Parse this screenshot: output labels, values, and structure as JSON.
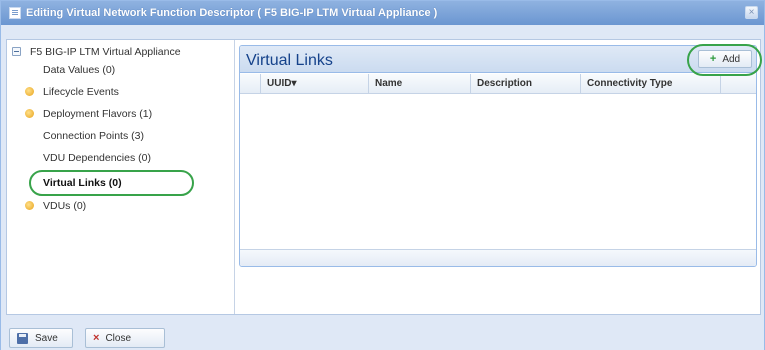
{
  "window": {
    "title": "Editing Virtual Network Function Descriptor ( F5 BIG-IP LTM Virtual Appliance )",
    "close_glyph": "×"
  },
  "tree": {
    "root": "F5 BIG-IP LTM Virtual Appliance",
    "items": [
      {
        "label": "Data Values (0)",
        "icon": "none"
      },
      {
        "label": "Lifecycle Events",
        "icon": "folder-icon"
      },
      {
        "label": "Deployment Flavors (1)",
        "icon": "folder-icon"
      },
      {
        "label": "Connection Points (3)",
        "icon": "none"
      },
      {
        "label": "VDU Dependencies (0)",
        "icon": "none"
      },
      {
        "label": "Virtual Links (0)",
        "icon": "none",
        "selected": true
      },
      {
        "label": "VDUs (0)",
        "icon": "folder-icon"
      }
    ]
  },
  "panel": {
    "title": "Virtual Links",
    "add_label": "Add",
    "add_icon": "+",
    "columns": [
      "UUID▾",
      "Name",
      "Description",
      "Connectivity Type"
    ]
  },
  "footer": {
    "save_label": "Save",
    "close_label": "Close",
    "close_icon": "×"
  },
  "colors": {
    "highlight": "#38a34a",
    "title_bar": "#6b96d1",
    "panel_title": "#15428b"
  }
}
